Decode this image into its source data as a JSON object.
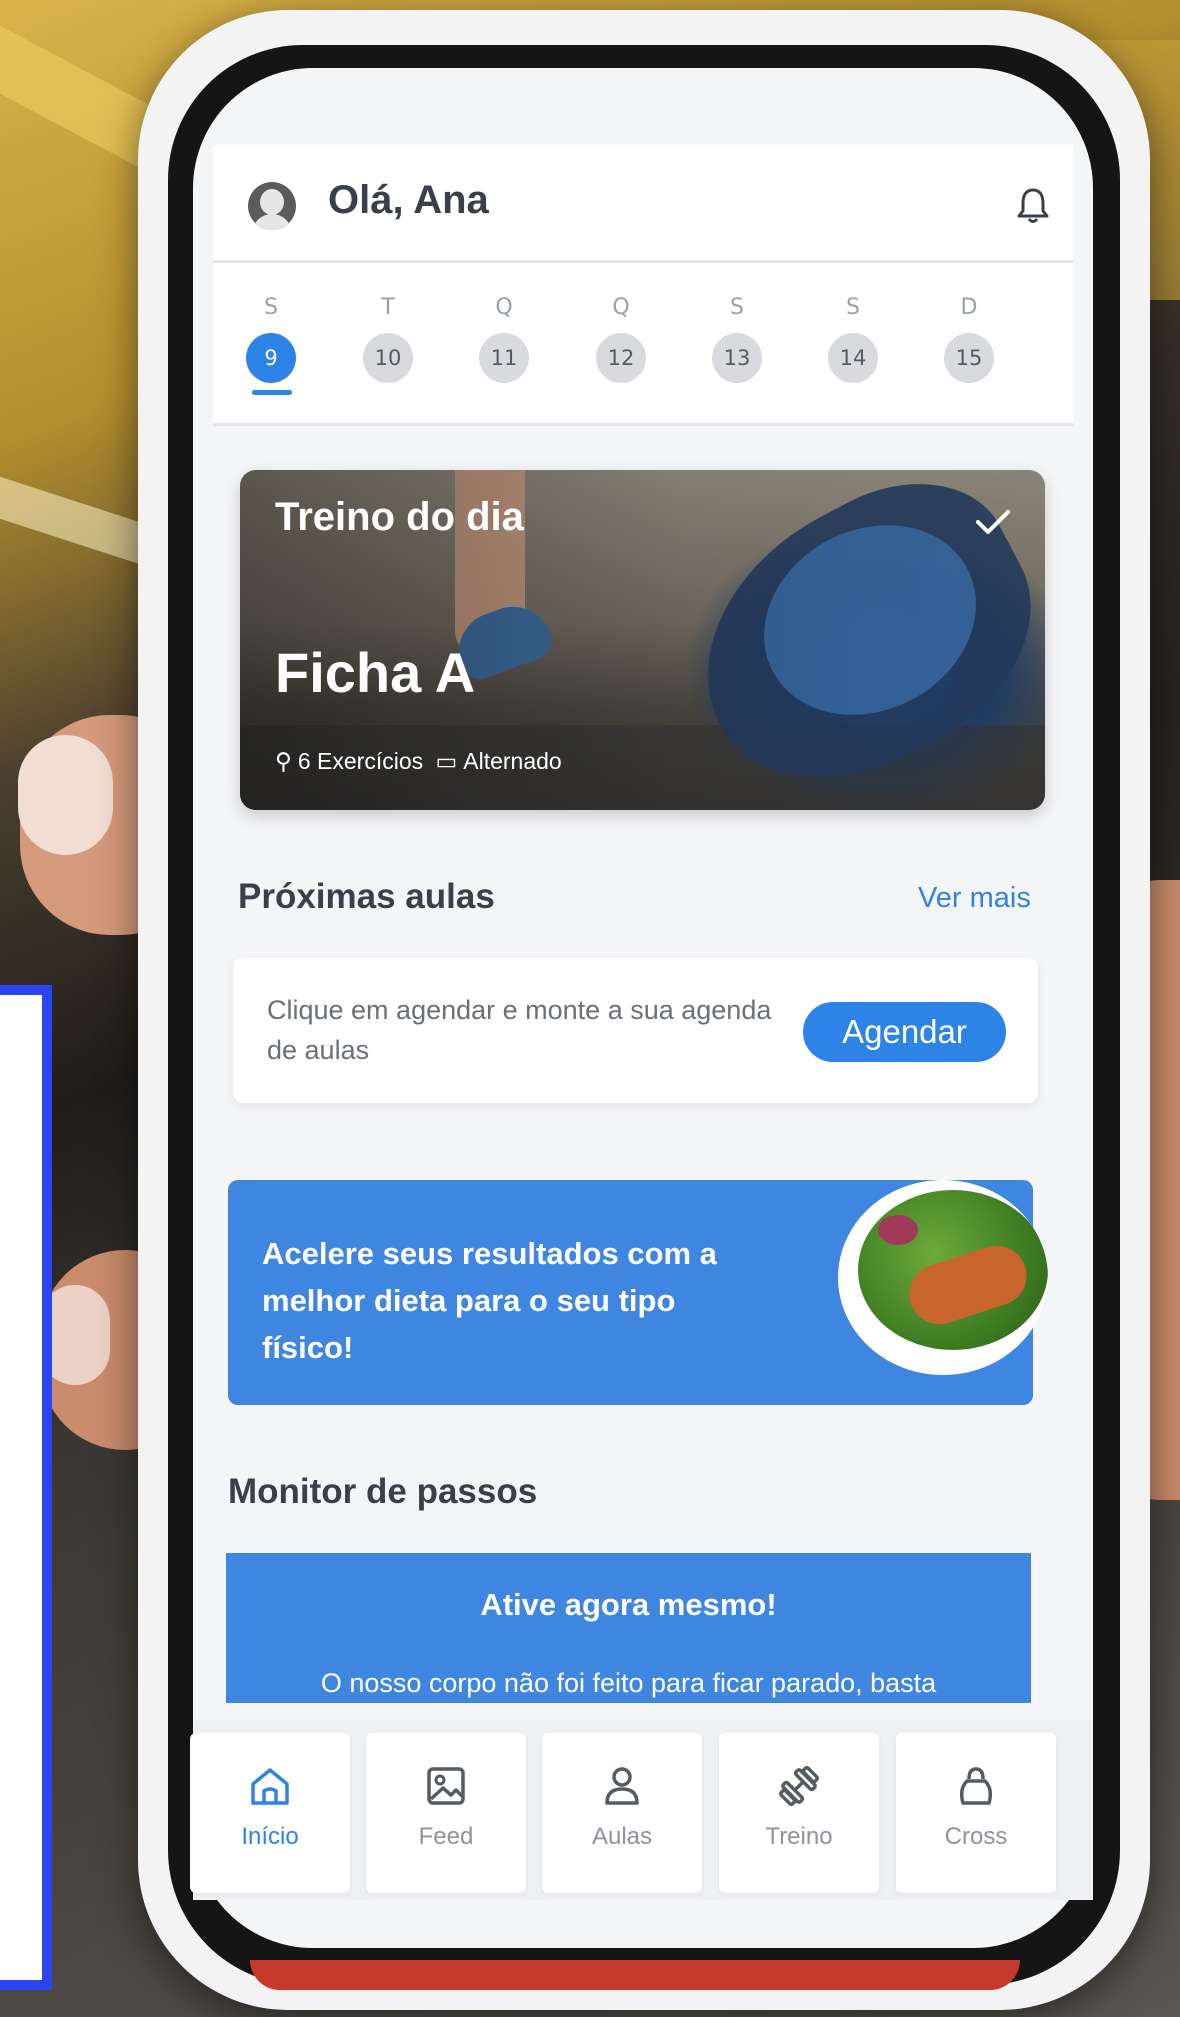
{
  "header": {
    "greeting": "Olá, Ana",
    "avatar_icon": "user-avatar-icon",
    "bell_icon": "bell-icon"
  },
  "week": {
    "days": [
      {
        "letter": "S",
        "num": "9",
        "active": true
      },
      {
        "letter": "T",
        "num": "10"
      },
      {
        "letter": "Q",
        "num": "11"
      },
      {
        "letter": "Q",
        "num": "12"
      },
      {
        "letter": "S",
        "num": "13"
      },
      {
        "letter": "S",
        "num": "14"
      },
      {
        "letter": "D",
        "num": "15"
      }
    ]
  },
  "workout": {
    "title": "Treino do dia",
    "name": "Ficha A",
    "exercises": "6 Exercícios",
    "schedule": "Alternado",
    "check_icon": "check-icon"
  },
  "classes": {
    "title": "Próximas aulas",
    "more": "Ver mais",
    "text": "Clique em agendar e monte a sua agenda de aulas",
    "button": "Agendar"
  },
  "diet": {
    "text": "Acelere seus resultados com a melhor dieta para o seu tipo físico!"
  },
  "steps": {
    "title": "Monitor de passos",
    "cta": "Ative agora mesmo!",
    "subtitle": "O nosso corpo não foi feito para ficar parado, basta"
  },
  "nav": {
    "items": [
      {
        "label": "Início",
        "icon": "home-icon",
        "active": true
      },
      {
        "label": "Feed",
        "icon": "image-icon"
      },
      {
        "label": "Aulas",
        "icon": "person-icon"
      },
      {
        "label": "Treino",
        "icon": "dumbbell-icon"
      },
      {
        "label": "Cross",
        "icon": "kettlebell-icon"
      }
    ]
  },
  "colors": {
    "accent": "#2d83e6",
    "banner": "#3f86e0",
    "highlight_frame": "#2b46f0"
  }
}
